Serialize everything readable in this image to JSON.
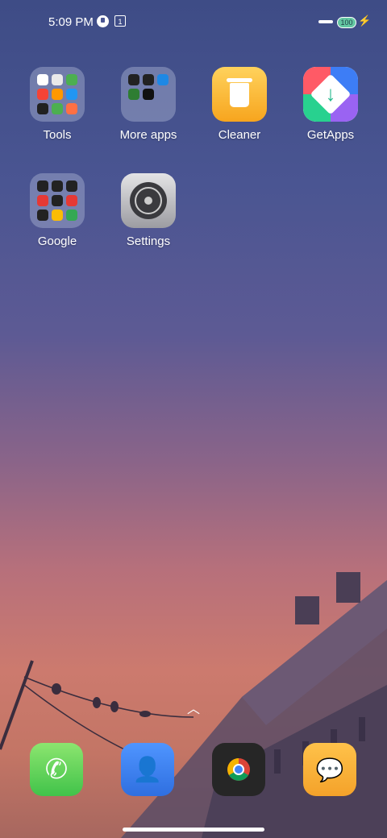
{
  "status_bar": {
    "time": "5:09 PM",
    "notification_badge": "1",
    "battery": "100"
  },
  "apps": [
    {
      "label": "Tools"
    },
    {
      "label": "More apps"
    },
    {
      "label": "Cleaner"
    },
    {
      "label": "GetApps"
    },
    {
      "label": "Google"
    },
    {
      "label": "Settings"
    }
  ],
  "dock": {
    "items": [
      "phone-icon",
      "contacts-icon",
      "chrome-icon",
      "messages-icon"
    ]
  },
  "colors": {
    "tools_minis": [
      "#5b8def",
      "#e7e7e7",
      "#4caf50",
      "#f44336",
      "#ff9800",
      "#2196f3",
      "#212121",
      "#4caf50",
      "#ff7043"
    ],
    "more_minis": [
      "#222",
      "#222",
      "#1e88e5",
      "#2e7d32",
      "#111"
    ],
    "google_minis": [
      "#222",
      "#222",
      "#222",
      "#e53935",
      "#222",
      "#e53935",
      "#222",
      "#fbbc05",
      "#34a853"
    ]
  }
}
